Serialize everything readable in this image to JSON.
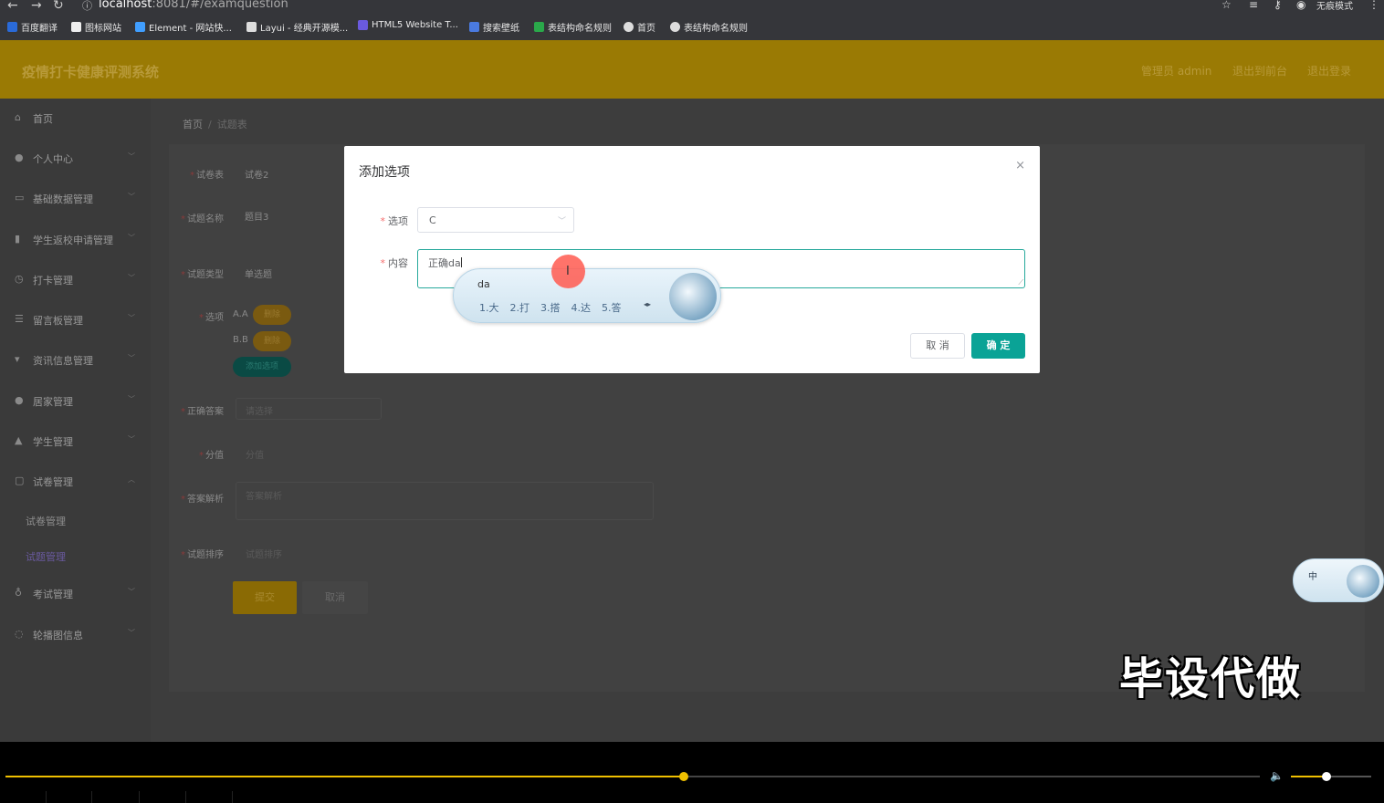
{
  "browser": {
    "url_host": "localhost",
    "url_path": ":8081/#/examquestion",
    "incognito_label": "无痕模式",
    "bookmarks": [
      {
        "label": "百度翻译",
        "color": "#2a6ad8"
      },
      {
        "label": "图标网站",
        "color": "#eeeeee"
      },
      {
        "label": "Element - 网站快...",
        "color": "#409eff"
      },
      {
        "label": "Layui - 经典开源模...",
        "color": "#dddddd"
      },
      {
        "label": "HTML5 Website T...",
        "color": "#6a5adf"
      },
      {
        "label": "搜索壁纸",
        "color": "#4a7adf"
      },
      {
        "label": "表结构命名规则",
        "color": "#2aa84a"
      },
      {
        "label": "首页",
        "color": "#dddddd"
      },
      {
        "label": "表结构命名规则",
        "color": "#dddddd"
      }
    ]
  },
  "app": {
    "title": "疫情打卡健康评测系统",
    "header_links": [
      "管理员 admin",
      "退出到前台",
      "退出登录"
    ]
  },
  "sidebar": {
    "items": [
      {
        "label": "首页",
        "icon": "home-icon",
        "glyph": "⌂",
        "has_chevron": false
      },
      {
        "label": "个人中心",
        "icon": "user-icon",
        "glyph": "●",
        "has_chevron": true
      },
      {
        "label": "基础数据管理",
        "icon": "list-icon",
        "glyph": "▭",
        "has_chevron": true
      },
      {
        "label": "学生返校申请管理",
        "icon": "bar-chart-icon",
        "glyph": "▮",
        "has_chevron": true
      },
      {
        "label": "打卡管理",
        "icon": "clock-icon",
        "glyph": "◷",
        "has_chevron": true
      },
      {
        "label": "留言板管理",
        "icon": "menu-icon",
        "glyph": "☰",
        "has_chevron": true
      },
      {
        "label": "资讯信息管理",
        "icon": "info-icon",
        "glyph": "▾",
        "has_chevron": true
      },
      {
        "label": "居家管理",
        "icon": "person-icon",
        "glyph": "●",
        "has_chevron": true
      },
      {
        "label": "学生管理",
        "icon": "student-icon",
        "glyph": "▲",
        "has_chevron": true
      },
      {
        "label": "试卷管理",
        "icon": "paper-icon",
        "glyph": "▢",
        "has_chevron": true,
        "expanded": true
      },
      {
        "label": "考试管理",
        "icon": "mic-icon",
        "glyph": "♁",
        "has_chevron": true
      },
      {
        "label": "轮播图信息",
        "icon": "image-icon",
        "glyph": "◌",
        "has_chevron": true
      }
    ],
    "sub_items": [
      {
        "label": "试卷管理",
        "active": false
      },
      {
        "label": "试题管理",
        "active": true
      }
    ]
  },
  "breadcrumb": {
    "home": "首页",
    "separator": "/",
    "current": "试题表"
  },
  "form": {
    "paper_label": "试卷表",
    "paper_value": "试卷2",
    "name_label": "试题名称",
    "name_value": "题目3",
    "type_label": "试题类型",
    "type_value": "单选题",
    "options_label": "选项",
    "options": [
      {
        "text": "A.A",
        "button": "删除"
      },
      {
        "text": "B.B",
        "button": "删除"
      }
    ],
    "add_option_button": "添加选项",
    "answer_label": "正确答案",
    "answer_placeholder": "请选择",
    "score_label": "分值",
    "score_placeholder": "分值",
    "analysis_label": "答案解析",
    "analysis_placeholder": "答案解析",
    "sort_label": "试题排序",
    "sort_placeholder": "试题排序",
    "submit_button": "提交",
    "cancel_button": "取消"
  },
  "dialog": {
    "title": "添加选项",
    "close_glyph": "×",
    "option_label": "选项",
    "option_value": "C",
    "content_label": "内容",
    "content_value": "正确da",
    "cancel_button": "取 消",
    "confirm_button": "确 定"
  },
  "ime": {
    "composition": "da",
    "candidates": [
      "1.大",
      "2.打",
      "3.搭",
      "4.达",
      "5.答"
    ],
    "status_label": "中"
  },
  "watermark": "毕设代做",
  "video": {
    "progress": 0.5407,
    "volume": 0.44,
    "accent_color": "#f0c000"
  }
}
